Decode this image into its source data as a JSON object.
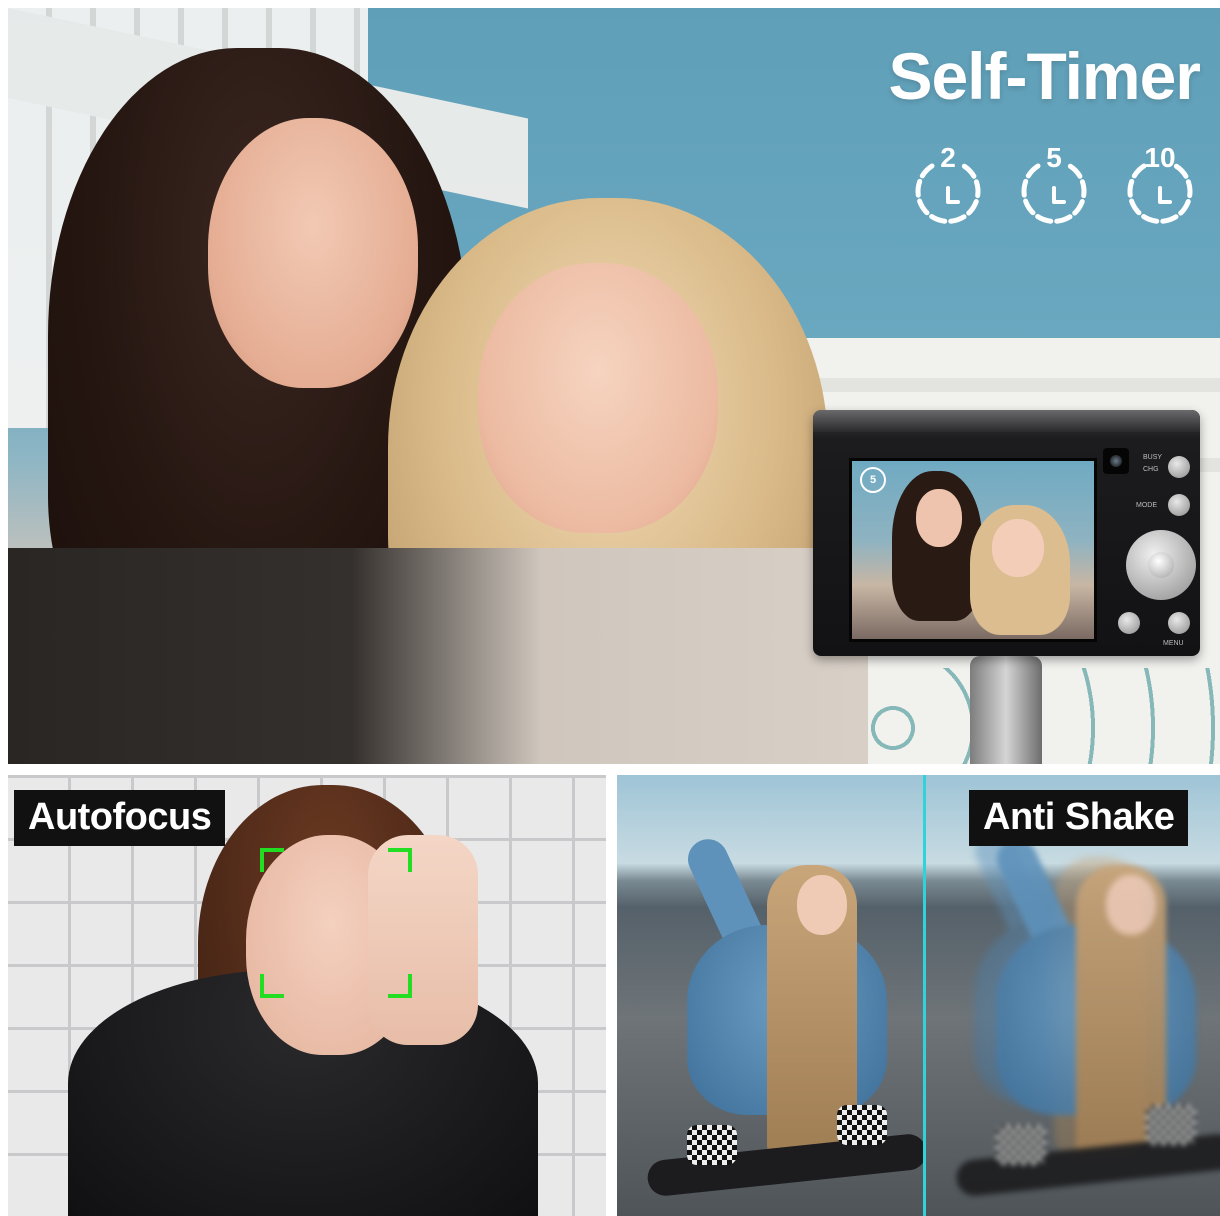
{
  "top_panel": {
    "title": "Self-Timer",
    "timer_options": [
      "2",
      "5",
      "10"
    ],
    "lcd_timer": "5"
  },
  "camera": {
    "labels": {
      "busy": "BUSY",
      "chg": "CHG",
      "mode": "MODE",
      "menu": "MENU"
    }
  },
  "bottom_left": {
    "label": "Autofocus",
    "focus_color": "#22dd22"
  },
  "bottom_right": {
    "label": "Anti Shake",
    "divider_color": "#2fd3d9"
  },
  "icons": [
    "timer-2s-icon",
    "timer-5s-icon",
    "timer-10s-icon",
    "autofocus-frame-icon"
  ]
}
